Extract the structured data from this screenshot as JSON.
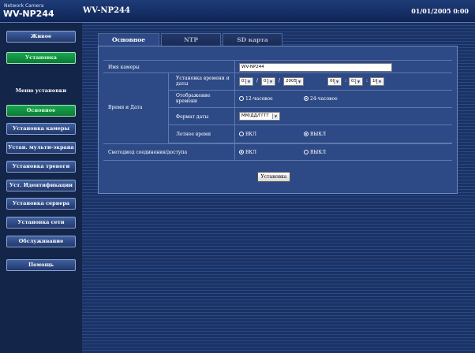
{
  "header": {
    "brand_small": "Network Camera",
    "brand_model": "WV-NP244",
    "title": "WV-NP244",
    "datetime": "01/01/2005 0:00"
  },
  "sidebar": {
    "live": "Живое",
    "setup": "Установка",
    "setup_menu_label": "Меню установки",
    "items": [
      "Основное",
      "Установка камеры",
      "Устан. мульти-экрана",
      "Установка тревоги",
      "Уст. Идентификации",
      "Установка сервера",
      "Установка сети",
      "Обслуживание"
    ],
    "help": "Помощь"
  },
  "tabs": [
    "Основное",
    "NTP",
    "SD карта памяти"
  ],
  "form": {
    "camera_name_label": "Имя камеры",
    "camera_name_value": "WV-NP244",
    "datetime_group_label": "Время и Дата",
    "set_time_label": "Установка времени и даты",
    "date_month": "01",
    "date_day": "01",
    "date_year": "2005",
    "time_hour": "00",
    "time_min": "01",
    "time_sec": "16",
    "slash": "/",
    "colon": ":",
    "time_display_label": "Отображение времени",
    "time_12": "12-часовое",
    "time_24": "24-часовое",
    "time_selected": "24",
    "date_format_label": "Формат даты",
    "date_format_value": "ММ/ДД/ГГГГ",
    "dst_label": "Летнее время",
    "on": "ВКЛ",
    "off": "ВЫКЛ",
    "dst_selected": "off",
    "led_label": "Светодиод соединения/доступа",
    "led_selected": "on",
    "submit": "Установка"
  },
  "colors": {
    "background": "#1a2b4a",
    "panel": "#2d4a86",
    "accent_green": "#0b7a36"
  }
}
